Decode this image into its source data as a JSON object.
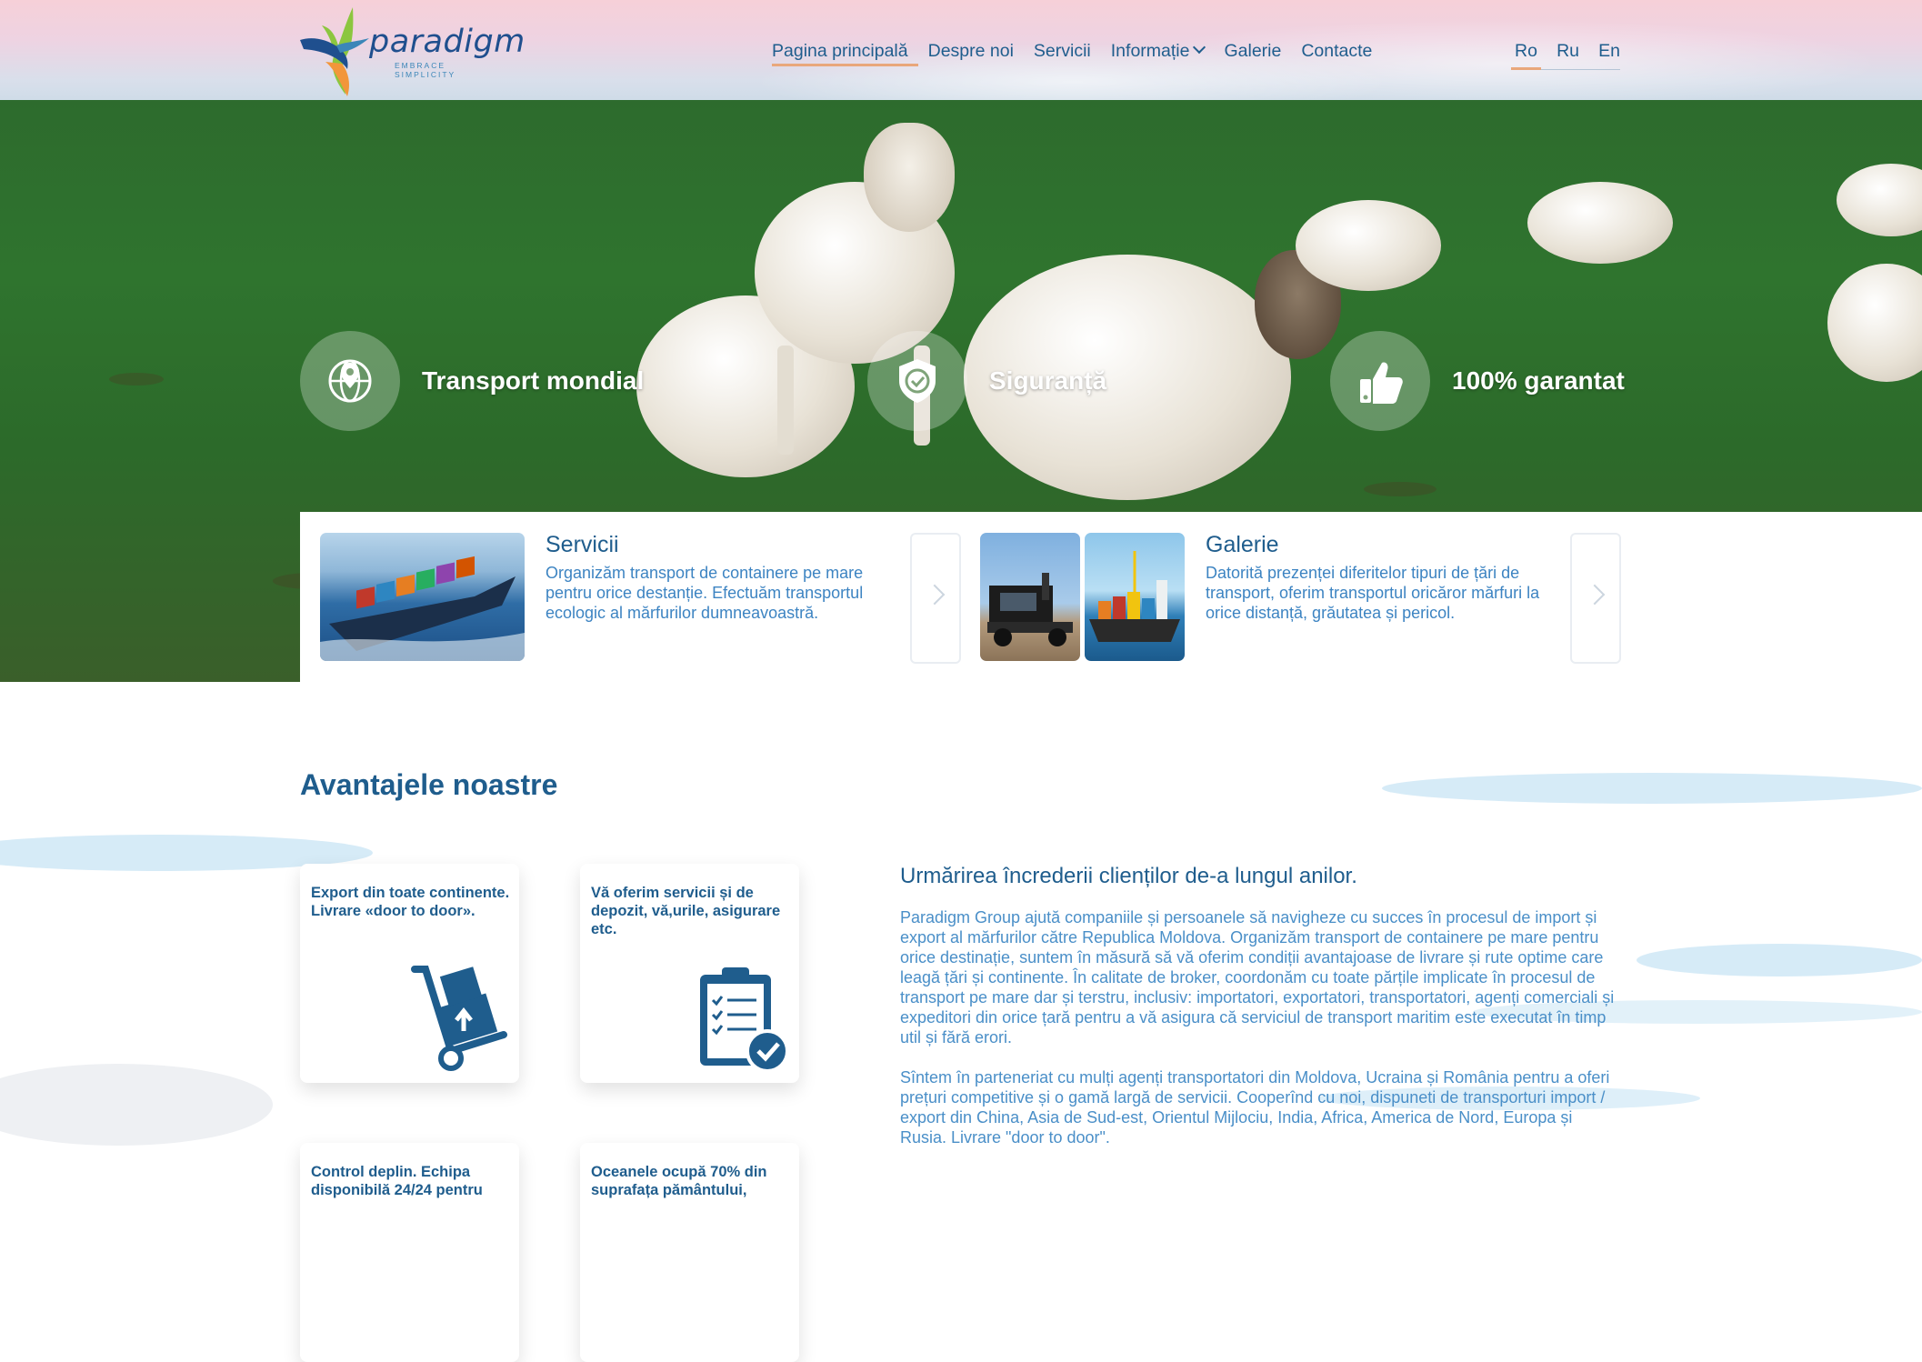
{
  "brand": {
    "name": "paradigm",
    "tagline": "EMBRACE SIMPLICITY",
    "accent": "#e9a77b",
    "primary": "#1f5d8d"
  },
  "nav": {
    "items": [
      {
        "label": "Pagina principală",
        "active": true
      },
      {
        "label": "Despre noi"
      },
      {
        "label": "Servicii"
      },
      {
        "label": "Informație",
        "dropdown": true
      },
      {
        "label": "Galerie"
      },
      {
        "label": "Contacte"
      }
    ]
  },
  "languages": [
    {
      "label": "Ro",
      "active": true
    },
    {
      "label": "Ru"
    },
    {
      "label": "En"
    }
  ],
  "hero": {
    "features": [
      {
        "label": "Transport mondial",
        "icon": "globe-pin-icon"
      },
      {
        "label": "Siguranță",
        "icon": "shield-check-icon"
      },
      {
        "label": "100% garantat",
        "icon": "thumbs-up-icon"
      }
    ]
  },
  "cards": [
    {
      "title": "Servicii",
      "text": "Organizăm transport de containere pe mare pentru orice destanție. Efectuăm transportul ecologic al mărfurilor dumneavoastră."
    },
    {
      "title": "Galerie",
      "text": "Datorită prezenței diferitelor tipuri de țări de transport, oferim transportul oricăror mărfuri la orice distanță, grăutatea și pericol."
    }
  ],
  "advantages": {
    "title": "Avantajele noastre",
    "cards": [
      {
        "text": "Export din toate continente. Livrare «door to door».",
        "icon": "hand-truck-icon"
      },
      {
        "text": "Vă oferim servicii și de depozit, vă,urile, asigurare etc.",
        "icon": "clipboard-check-icon"
      },
      {
        "text": "Control deplin. Echipa disponibilă 24/24 pentru"
      },
      {
        "text": "Oceanele ocupă 70% din suprafața pământului,"
      }
    ]
  },
  "trust": {
    "title": "Urmărirea încrederii clienților de-a lungul anilor.",
    "p1": "Paradigm Group ajută companiile și persoanele să navigheze cu succes în procesul de import și export al mărfurilor către Republica Moldova. Organizăm transport de containere pe mare pentru orice destinație, suntem în măsură să vă oferim condiții avantajoase de livrare și rute optime care leagă țări și continente. În calitate de broker, coordonăm cu toate părțile implicate în procesul de transport pe mare dar și terstru, inclusiv: importatori, exportatori, transportatori, agenți comerciali și expeditori din orice țară pentru a vă asigura că serviciul de transport maritim este executat în timp util și fără erori.",
    "p2": "Sîntem în parteneriat cu mulți agenți transportatori din Moldova, Ucraina și România pentru a oferi prețuri competitive și o gamă largă de servicii. Cooperînd cu noi, dispuneti de transporturi import / export din China, Asia de Sud-est, Orientul Mijlociu, India, Africa, America de Nord, Europa și Rusia. Livrare \"door to door\"."
  }
}
